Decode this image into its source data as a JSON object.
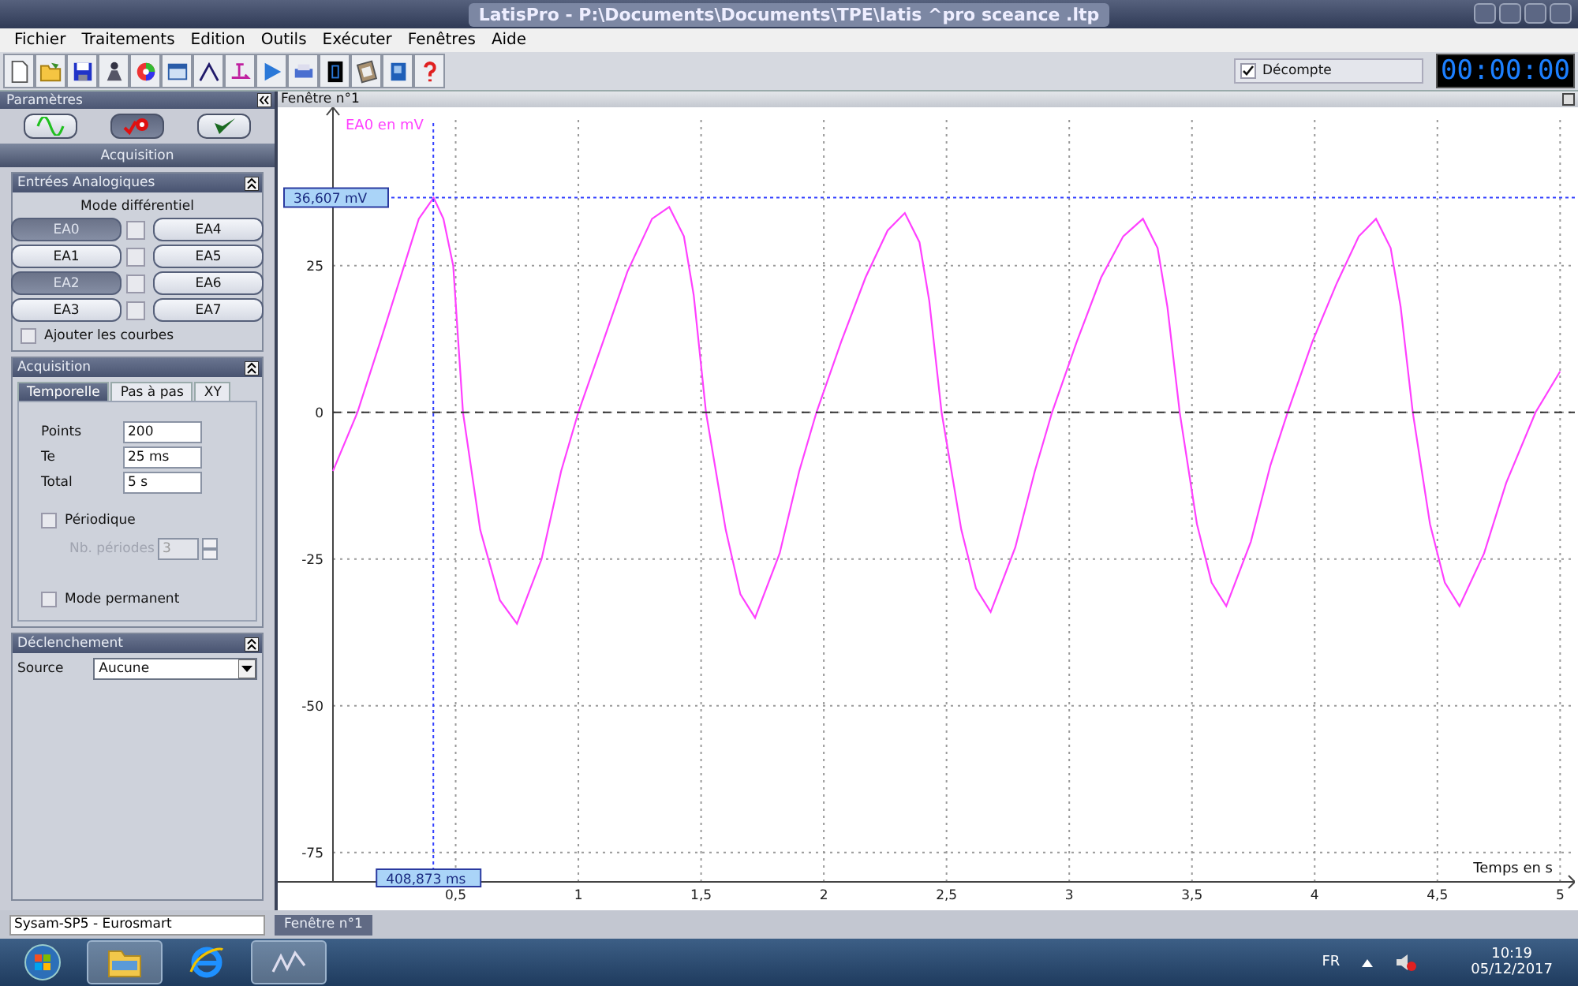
{
  "window": {
    "title": "LatisPro - P:\\Documents\\Documents\\TPE\\latis ^pro sceance .ltp"
  },
  "menu": [
    "Fichier",
    "Traitements",
    "Edition",
    "Outils",
    "Exécuter",
    "Fenêtres",
    "Aide"
  ],
  "toolbar": {
    "countdown": {
      "label": "Décompte",
      "checked": true
    },
    "clock": "00:00:00"
  },
  "parameters": {
    "title": "Paramètres",
    "modes": [
      {
        "kind": "sine",
        "selected": false
      },
      {
        "kind": "acquire",
        "selected": true
      },
      {
        "kind": "validate",
        "selected": false
      }
    ],
    "section_title": "Acquisition",
    "analog_inputs": {
      "title": "Entrées Analogiques",
      "mode_label": "Mode différentiel",
      "channels": [
        {
          "label": "EA0",
          "selected": true
        },
        {
          "label": "EA1",
          "selected": false
        },
        {
          "label": "EA2",
          "selected": true
        },
        {
          "label": "EA3",
          "selected": false
        },
        {
          "label": "EA4",
          "selected": false
        },
        {
          "label": "EA5",
          "selected": false
        },
        {
          "label": "EA6",
          "selected": false
        },
        {
          "label": "EA7",
          "selected": false
        }
      ],
      "differential": [
        {
          "checked": false
        },
        {
          "checked": false
        },
        {
          "checked": false
        },
        {
          "checked": false
        }
      ],
      "add_curves": {
        "label": "Ajouter les courbes",
        "checked": false
      }
    },
    "acquisition": {
      "title": "Acquisition",
      "tabs": [
        {
          "label": "Temporelle",
          "selected": true
        },
        {
          "label": "Pas à pas",
          "selected": false
        },
        {
          "label": "XY",
          "selected": false
        }
      ],
      "fields": [
        {
          "label": "Points",
          "value": "200"
        },
        {
          "label": "Te",
          "value": "25 ms"
        },
        {
          "label": "Total",
          "value": "5 s"
        }
      ],
      "periodic": {
        "label": "Périodique",
        "checked": false
      },
      "periods": {
        "label": "Nb. périodes",
        "value": "3",
        "disabled": true
      },
      "permanent": {
        "label": "Mode permanent",
        "checked": false
      }
    },
    "trigger": {
      "title": "Déclenchement",
      "source_label": "Source",
      "source": "Aucune"
    }
  },
  "graph": {
    "title": "Fenêtre n°1",
    "chart_data": {
      "type": "line",
      "xlabel": "Temps en s",
      "ylabel": "EA0 en mV",
      "xlim": [
        -0.225,
        5.06
      ],
      "ylim": [
        -80,
        52
      ],
      "grid": true,
      "xticks": [
        {
          "value": 0.5,
          "label": "0,5"
        },
        {
          "value": 1,
          "label": "1"
        },
        {
          "value": 1.5,
          "label": "1,5"
        },
        {
          "value": 2,
          "label": "2"
        },
        {
          "value": 2.5,
          "label": "2,5"
        },
        {
          "value": 3,
          "label": "3"
        },
        {
          "value": 3.5,
          "label": "3,5"
        },
        {
          "value": 4,
          "label": "4"
        },
        {
          "value": 4.5,
          "label": "4,5"
        },
        {
          "value": 5,
          "label": "5"
        }
      ],
      "yticks": [
        25,
        0,
        -25,
        -50,
        -75
      ],
      "x": [
        0,
        0.1,
        0.2,
        0.29,
        0.35,
        0.41,
        0.45,
        0.49,
        0.53,
        0.6,
        0.68,
        0.75,
        0.85,
        0.93,
        1.0,
        1.1,
        1.2,
        1.3,
        1.37,
        1.43,
        1.47,
        1.52,
        1.6,
        1.66,
        1.72,
        1.82,
        1.9,
        1.97,
        2.07,
        2.17,
        2.26,
        2.33,
        2.39,
        2.43,
        2.48,
        2.56,
        2.62,
        2.68,
        2.78,
        2.86,
        2.93,
        3.03,
        3.13,
        3.22,
        3.3,
        3.36,
        3.4,
        3.45,
        3.52,
        3.58,
        3.64,
        3.74,
        3.82,
        3.89,
        3.99,
        4.09,
        4.18,
        4.25,
        4.31,
        4.35,
        4.4,
        4.47,
        4.53,
        4.59,
        4.69,
        4.78,
        4.9,
        5.0
      ],
      "series": [
        {
          "color": "#ff40ff",
          "values": [
            -10,
            0,
            13,
            25,
            33,
            36.6,
            33,
            25,
            0,
            -20,
            -32,
            -36,
            -25,
            -10,
            0,
            12,
            24,
            33,
            35,
            30,
            20,
            0,
            -20,
            -31,
            -35,
            -24,
            -10,
            0,
            12,
            23,
            31,
            34,
            29,
            19,
            0,
            -20,
            -30,
            -34,
            -23,
            -10,
            0,
            12,
            23,
            30,
            33,
            28,
            18,
            0,
            -19,
            -29,
            -33,
            -22,
            -9,
            0,
            12,
            22,
            30,
            33,
            28,
            18,
            0,
            -19,
            -29,
            -33,
            -24,
            -12,
            0,
            7
          ]
        }
      ],
      "ref_lines": [
        {
          "axis": "y",
          "value": 0,
          "color": "#333333"
        },
        {
          "axis": "x",
          "value": 0.409,
          "color": "#3340ff",
          "label": "408,873 ms"
        },
        {
          "axis": "y",
          "value": 36.607,
          "color": "#3340ff",
          "label": "36,607 mV"
        }
      ]
    }
  },
  "status_bar": {
    "device": "Sysam-SP5 - Eurosmart",
    "tabs": [
      {
        "label": "Fenêtre n°1",
        "selected": true
      }
    ]
  },
  "taskbar": {
    "language": "FR",
    "time": "10:19",
    "date": "05/12/2017"
  }
}
